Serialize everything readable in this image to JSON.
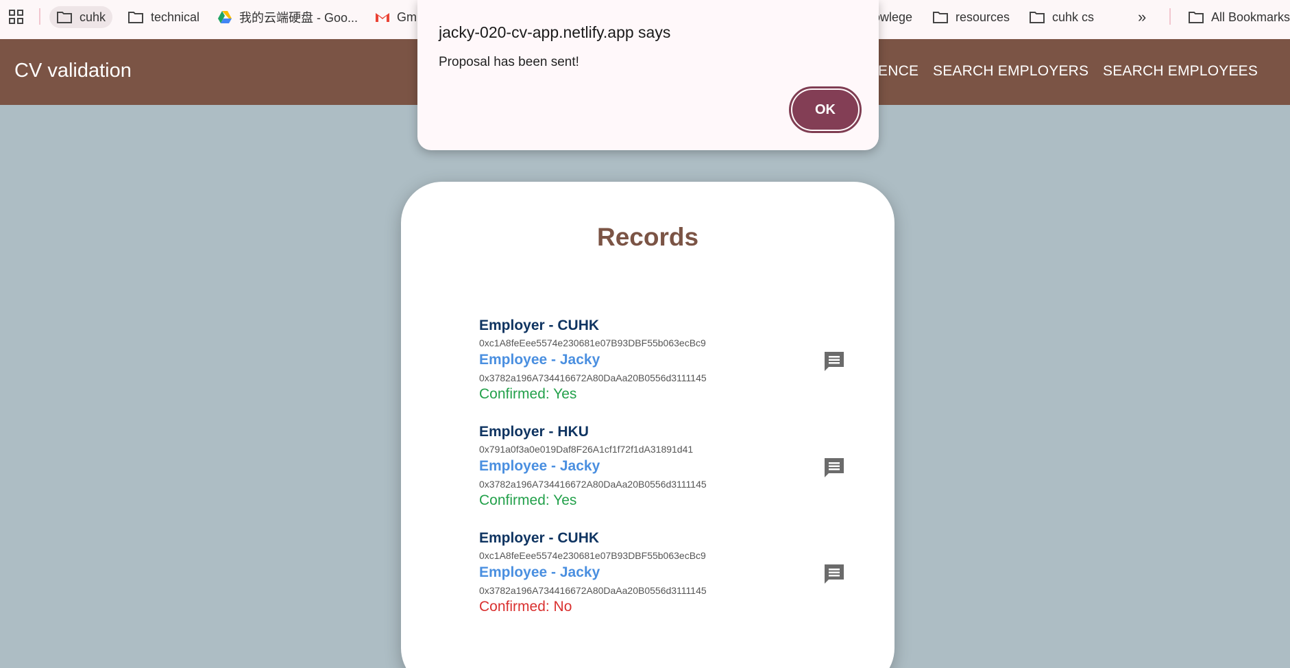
{
  "bookmarks": {
    "items": [
      {
        "label": "cuhk",
        "icon": "folder-icon"
      },
      {
        "label": "technical",
        "icon": "folder-icon"
      },
      {
        "label": "我的云端硬盘 - Goo...",
        "icon": "google-drive-icon"
      },
      {
        "label": "Gm",
        "icon": "gmail-icon"
      },
      {
        "label": "owlege",
        "icon": "folder-icon"
      },
      {
        "label": "resources",
        "icon": "folder-icon"
      },
      {
        "label": "cuhk cs",
        "icon": "folder-icon"
      }
    ],
    "more_label": "»",
    "all_bookmarks": "All Bookmarks"
  },
  "header": {
    "title": "CV validation",
    "nav": [
      "ENCE",
      "SEARCH EMPLOYERS",
      "SEARCH EMPLOYEES"
    ]
  },
  "main": {
    "title": "Records",
    "records": [
      {
        "employer": "Employer - CUHK",
        "employer_address": "0xc1A8feEee5574e230681e07B93DBF55b063ecBc9",
        "employee": "Employee - Jacky",
        "employee_address": "0x3782a196A734416672A80DaAa20B0556d3111145",
        "confirmed": "Confirmed: Yes"
      },
      {
        "employer": "Employer - HKU",
        "employer_address": "0x791a0f3a0e019Daf8F26A1cf1f72f1dA31891d41",
        "employee": "Employee - Jacky",
        "employee_address": "0x3782a196A734416672A80DaAa20B0556d3111145",
        "confirmed": "Confirmed: Yes"
      },
      {
        "employer": "Employer - CUHK",
        "employer_address": "0xc1A8feEee5574e230681e07B93DBF55b063ecBc9",
        "employee": "Employee - Jacky",
        "employee_address": "0x3782a196A734416672A80DaAa20B0556d3111145",
        "confirmed": "Confirmed: No"
      }
    ]
  },
  "dialog": {
    "title": "jacky-020-cv-app.netlify.app says",
    "message": "Proposal has been sent!",
    "ok_label": "OK"
  },
  "colors": {
    "header_bg": "#7b5445",
    "page_bg": "#adbdc4",
    "confirmed_yes": "#22a04a",
    "confirmed_no": "#d9302f",
    "employer_text": "#0f3461",
    "employee_text": "#4a8fe0",
    "ok_button": "#833e55"
  }
}
